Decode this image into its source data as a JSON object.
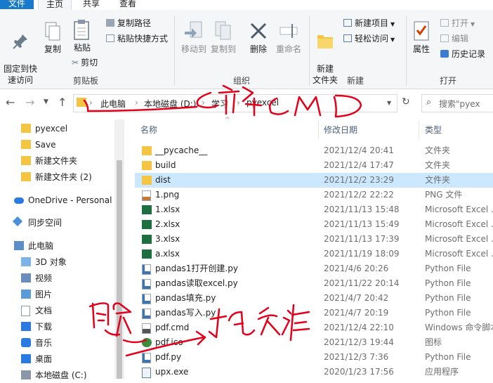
{
  "tabs": {
    "file": "文件",
    "home": "主页",
    "share": "共享",
    "view": "查看"
  },
  "ribbon": {
    "pin": "固定到快\n速访问",
    "copy": "复制",
    "paste": "粘贴",
    "copy_path": "复制路径",
    "paste_shortcut": "粘贴快捷方式",
    "cut": "剪切",
    "group_clipboard": "剪贴板",
    "move_to": "移动到",
    "copy_to": "复制到",
    "delete": "删除",
    "rename": "重命名",
    "group_organize": "组织",
    "new_folder": "新建\n文件夹",
    "new_item": "新建项目",
    "easy_access": "轻松访问",
    "group_new": "新建",
    "properties": "属性",
    "open": "打开",
    "edit": "编辑",
    "history": "历史记录",
    "group_open": "打开"
  },
  "address": {
    "crumbs": [
      "此电脑",
      "本地磁盘 (D:)",
      "学习",
      "pyexcel"
    ],
    "search_placeholder": "搜索\"pyex"
  },
  "sidebar": {
    "items": [
      {
        "label": "pyexcel",
        "icon": "folder-icon"
      },
      {
        "label": "Save",
        "icon": "folder-icon"
      },
      {
        "label": "新建文件夹",
        "icon": "folder-icon"
      },
      {
        "label": "新建文件夹 (2)",
        "icon": "folder-icon"
      },
      {
        "label": "OneDrive - Personal",
        "icon": "cloud-icon"
      },
      {
        "label": "同步空间",
        "icon": "sync-icon"
      },
      {
        "label": "此电脑",
        "icon": "computer-icon"
      },
      {
        "label": "3D 对象",
        "icon": "cube-icon"
      },
      {
        "label": "视频",
        "icon": "video-icon"
      },
      {
        "label": "图片",
        "icon": "picture-icon"
      },
      {
        "label": "文档",
        "icon": "document-icon"
      },
      {
        "label": "下载",
        "icon": "download-icon"
      },
      {
        "label": "音乐",
        "icon": "music-icon"
      },
      {
        "label": "桌面",
        "icon": "desktop-icon"
      },
      {
        "label": "本地磁盘 (C:)",
        "icon": "drive-icon"
      }
    ]
  },
  "columns": {
    "name": "名称",
    "date": "修改日期",
    "type": "类型"
  },
  "files": [
    {
      "name": "__pycache__",
      "date": "2021/12/4 20:41",
      "type": "文件夹",
      "icon": "folder-icon"
    },
    {
      "name": "build",
      "date": "2021/12/4 17:47",
      "type": "文件夹",
      "icon": "folder-icon"
    },
    {
      "name": "dist",
      "date": "2021/12/2 23:29",
      "type": "文件夹",
      "icon": "folder-icon"
    },
    {
      "name": "1.png",
      "date": "2021/12/2 22:22",
      "type": "PNG 文件",
      "icon": "image-file-icon"
    },
    {
      "name": "1.xlsx",
      "date": "2021/11/13 15:48",
      "type": "Microsoft Excel ...",
      "icon": "excel-file-icon"
    },
    {
      "name": "2.xlsx",
      "date": "2021/11/13 15:49",
      "type": "Microsoft Excel ...",
      "icon": "excel-file-icon"
    },
    {
      "name": "3.xlsx",
      "date": "2021/11/13 17:39",
      "type": "Microsoft Excel ...",
      "icon": "excel-file-icon"
    },
    {
      "name": "a.xlsx",
      "date": "2021/11/19 18:09",
      "type": "Microsoft Excel ...",
      "icon": "excel-file-icon"
    },
    {
      "name": "pandas1打开创建.py",
      "date": "2021/4/6 20:26",
      "type": "Python File",
      "icon": "python-file-icon"
    },
    {
      "name": "pandas读取excel.py",
      "date": "2021/11/22 20:14",
      "type": "Python File",
      "icon": "python-file-icon"
    },
    {
      "name": "pandas填充.py",
      "date": "2021/4/7 20:42",
      "type": "Python File",
      "icon": "python-file-icon"
    },
    {
      "name": "pandas写入.py",
      "date": "2021/4/7 20:19",
      "type": "Python File",
      "icon": "python-file-icon"
    },
    {
      "name": "pdf.cmd",
      "date": "2021/12/4 22:10",
      "type": "Windows 命令脚本",
      "icon": "cmd-file-icon"
    },
    {
      "name": "pdf.ico",
      "date": "2021/12/3 19:44",
      "type": "图标",
      "icon": "ico-file-icon"
    },
    {
      "name": "pdf.py",
      "date": "2021/12/3 7:36",
      "type": "Python File",
      "icon": "python-file-icon"
    },
    {
      "name": "upx.exe",
      "date": "2020/1/23 17:56",
      "type": "应用程序",
      "icon": "exe-file-icon"
    }
  ],
  "colors": {
    "accent": "#1979ca",
    "selected_row": "#cce8ff",
    "folder": "#f4c542",
    "excel": "#1d6f42",
    "ink": "#e4001b"
  }
}
